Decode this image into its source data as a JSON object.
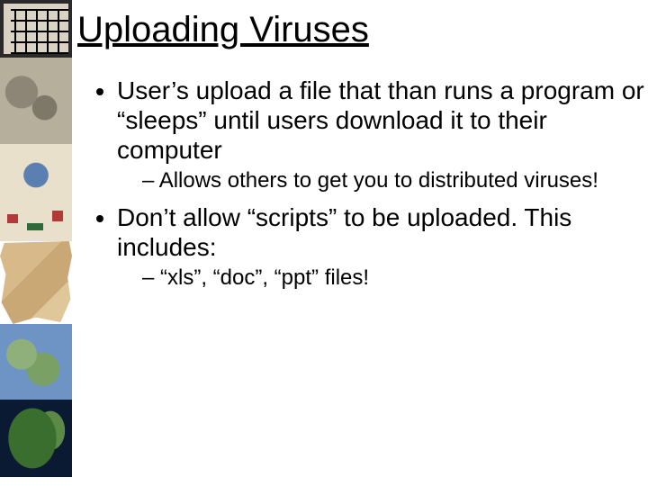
{
  "title": "Uploading Viruses",
  "bullets": {
    "b1": "User’s upload a file that than runs a program or “sleeps” until users download it to their computer",
    "b1_sub1": "Allows others to get you to distributed viruses!",
    "b2": "Don’t allow “scripts” to be uploaded.  This includes:",
    "b2_sub1": "“xls”, “doc”, “ppt” files!"
  },
  "sidebar": {
    "items": [
      {
        "name": "thumb-labyrinth"
      },
      {
        "name": "thumb-cuneiform-tablet"
      },
      {
        "name": "thumb-antique-map"
      },
      {
        "name": "thumb-parchment-map"
      },
      {
        "name": "thumb-relief-map"
      },
      {
        "name": "thumb-satellite-earth"
      }
    ]
  }
}
